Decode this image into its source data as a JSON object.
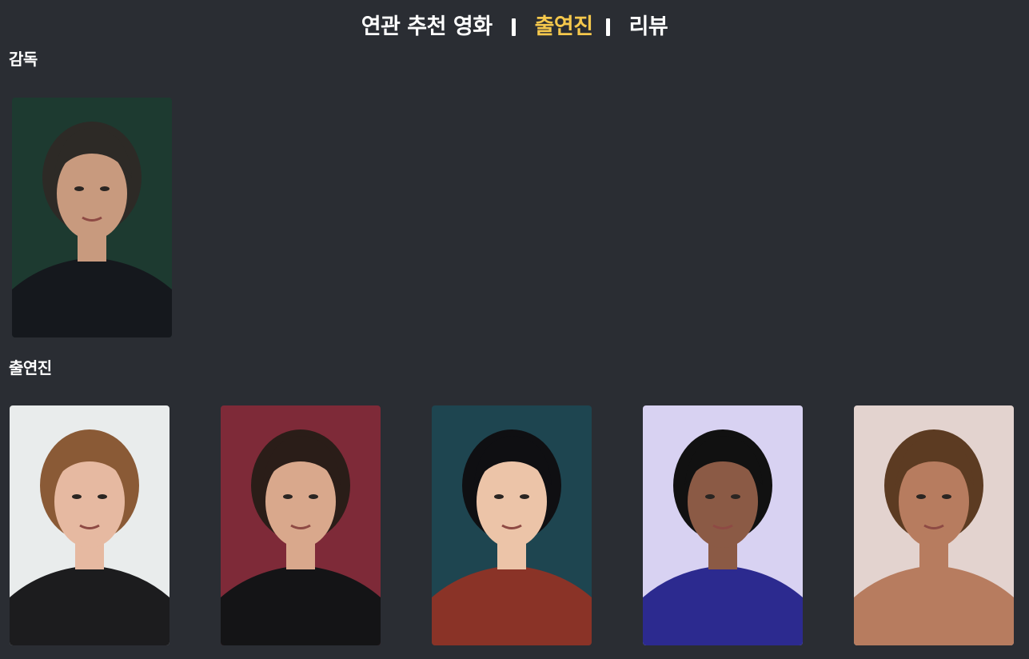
{
  "tabs": [
    {
      "label": "연관 추천 영화",
      "active": false
    },
    {
      "label": "출연진",
      "active": true
    },
    {
      "label": "리뷰",
      "active": false
    }
  ],
  "directors_section": {
    "title": "감독",
    "people": [
      {
        "photo": "director-photo",
        "bg": "#1d3a30",
        "skin": "#c89a7e",
        "hair": "#2d2a26",
        "shirt": "#15181d"
      }
    ]
  },
  "cast_section": {
    "title": "출연진",
    "people": [
      {
        "photo": "cast-photo-1",
        "bg": "#e9ecec",
        "skin": "#e6b9a1",
        "hair": "#8a5a36",
        "shirt": "#1c1c1e"
      },
      {
        "photo": "cast-photo-2",
        "bg": "#7e2a38",
        "skin": "#d9a88c",
        "hair": "#2a1d18",
        "shirt": "#141416"
      },
      {
        "photo": "cast-photo-3",
        "bg": "#1e4550",
        "skin": "#ecc4a8",
        "hair": "#0f0f12",
        "shirt": "#8a3327"
      },
      {
        "photo": "cast-photo-4",
        "bg": "#d8d2f2",
        "skin": "#8b5a45",
        "hair": "#111111",
        "shirt": "#2c2a8f"
      },
      {
        "photo": "cast-photo-5",
        "bg": "#e3d3cf",
        "skin": "#b77c5f",
        "hair": "#5c3b22",
        "shirt": "#b77c5f"
      }
    ]
  }
}
